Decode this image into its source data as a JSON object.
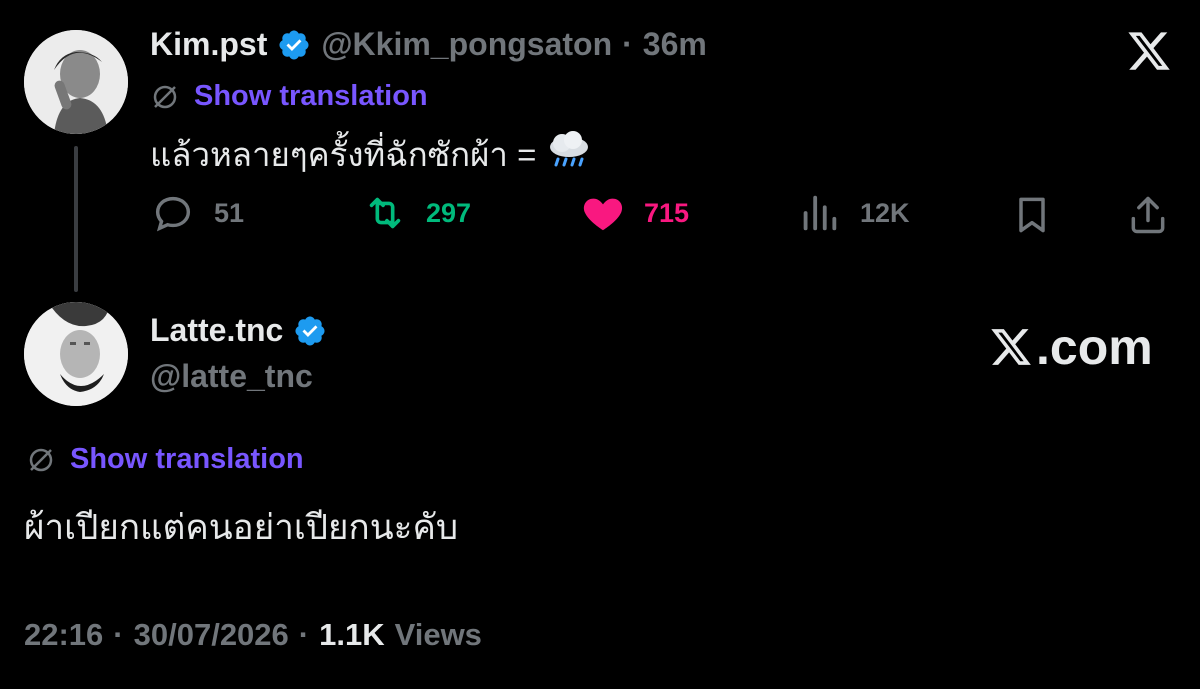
{
  "tweet": {
    "author_name": "Kim.pst",
    "handle": "@Kkim_pongsaton",
    "separator": "·",
    "time_ago": "36m",
    "show_translation": "Show translation",
    "text": "แล้วหลายๆครั้งที่ฉักซักผ้า =",
    "emoji": "🌧️",
    "stats": {
      "replies": "51",
      "retweets": "297",
      "likes": "715",
      "views": "12K"
    }
  },
  "reply": {
    "author_name": "Latte.tnc",
    "handle": "@latte_tnc",
    "show_translation": "Show translation",
    "text": "ผ้าเปียกแต่คนอย่าเปียกนะคับ",
    "time": "22:16",
    "date": "30/07/2026",
    "views_count": "1.1K",
    "views_label": "Views"
  },
  "watermark": {
    "text": ".com"
  },
  "colors": {
    "background": "#000000",
    "text": "#e7e9ea",
    "muted": "#71767b",
    "link": "#7856ff",
    "verified": "#1d9bf0",
    "retweet": "#00ba7c",
    "like": "#f91880"
  }
}
